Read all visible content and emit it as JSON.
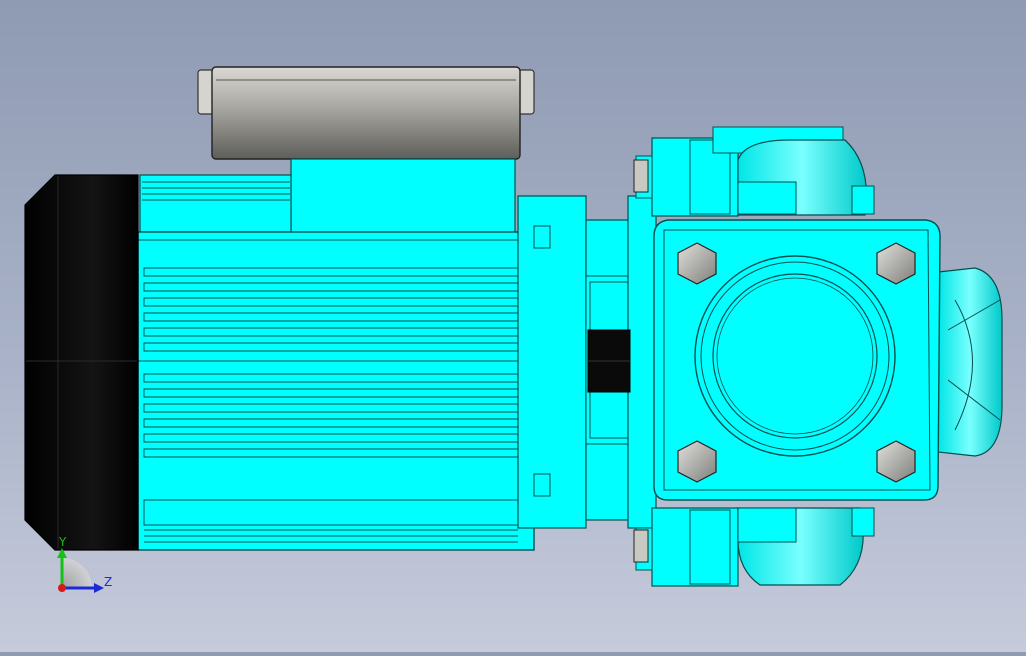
{
  "viewport": {
    "background_top": "#8f9bb3",
    "background_bottom": "#c6cbdb"
  },
  "model": {
    "body_color": "#00ffff",
    "body_shade": "#00d7d7",
    "edge_color": "#00504f",
    "fan_cover_color": "#0a0a0a",
    "terminal_box_color": "#8a8a86"
  },
  "triad": {
    "y_label": "Y",
    "z_label": "Z",
    "y_color": "#16c016",
    "z_color": "#1a2ad8",
    "x_color": "#d81818"
  }
}
